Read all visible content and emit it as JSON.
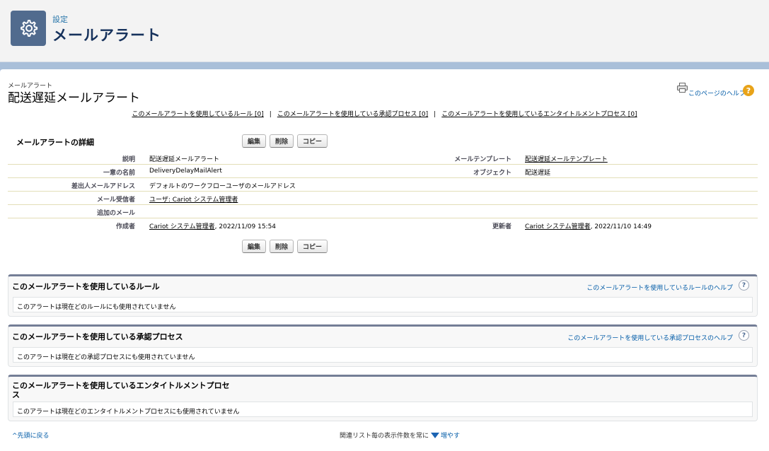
{
  "header": {
    "breadcrumb": "設定",
    "title": "メールアラート",
    "icon": "gear-icon"
  },
  "page": {
    "subtitle": "メールアラート",
    "title": "配送遅延メールアラート",
    "help_link": "このページのヘルプ",
    "related_links": [
      "このメールアラートを使用しているルール [0]",
      "このメールアラートを使用している承認プロセス [0]",
      "このメールアラートを使用しているエンタイトルメントプロセス [0]"
    ],
    "separator": "|"
  },
  "detail": {
    "section_title": "メールアラートの詳細",
    "buttons": {
      "edit": "編集",
      "delete": "削除",
      "copy": "コピー"
    },
    "rows": [
      {
        "label": "説明",
        "value": "配送遅延メールアラート",
        "label2": "メールテンプレート",
        "value2": "配送遅延メールテンプレート"
      },
      {
        "label": "一意の名前",
        "value": "DeliveryDelayMailAlert",
        "label2": "オブジェクト",
        "value2": "配送遅延"
      },
      {
        "label": "差出人メールアドレス",
        "value": "デフォルトのワークフローユーザのメールアドレス"
      },
      {
        "label": "メール受信者",
        "value": "ユーザ: Cariot システム管理者"
      },
      {
        "label": "追加のメール",
        "value": ""
      },
      {
        "label": "作成者",
        "value_link": "Cariot システム管理者",
        "value_date": ", 2022/11/09 15:54",
        "label2": "更新者",
        "value2_link": "Cariot システム管理者",
        "value2_date": ", 2022/11/10 14:49"
      }
    ]
  },
  "related_lists": [
    {
      "title": "このメールアラートを使用しているルール",
      "help": "このメールアラートを使用しているルールのヘルプ",
      "empty": "このアラートは現在どのルールにも使用されていません"
    },
    {
      "title": "このメールアラートを使用している承認プロセス",
      "help": "このメールアラートを使用している承認プロセスのヘルプ",
      "empty": "このアラートは現在どの承認プロセスにも使用されていません"
    },
    {
      "title": "このメールアラートを使用しているエンタイトルメントプロセス",
      "help": "",
      "empty": "このアラートは現在どのエンタイトルメントプロセスにも使用されていません"
    }
  ],
  "footer": {
    "back_to_top": "先頭に戻る",
    "show_more_prefix": "関連リスト毎の表示件数を常に",
    "show_more": "増やす"
  },
  "colors": {
    "link": "#015ba7",
    "help_badge": "#e8a319",
    "tile": "#516b8e"
  }
}
